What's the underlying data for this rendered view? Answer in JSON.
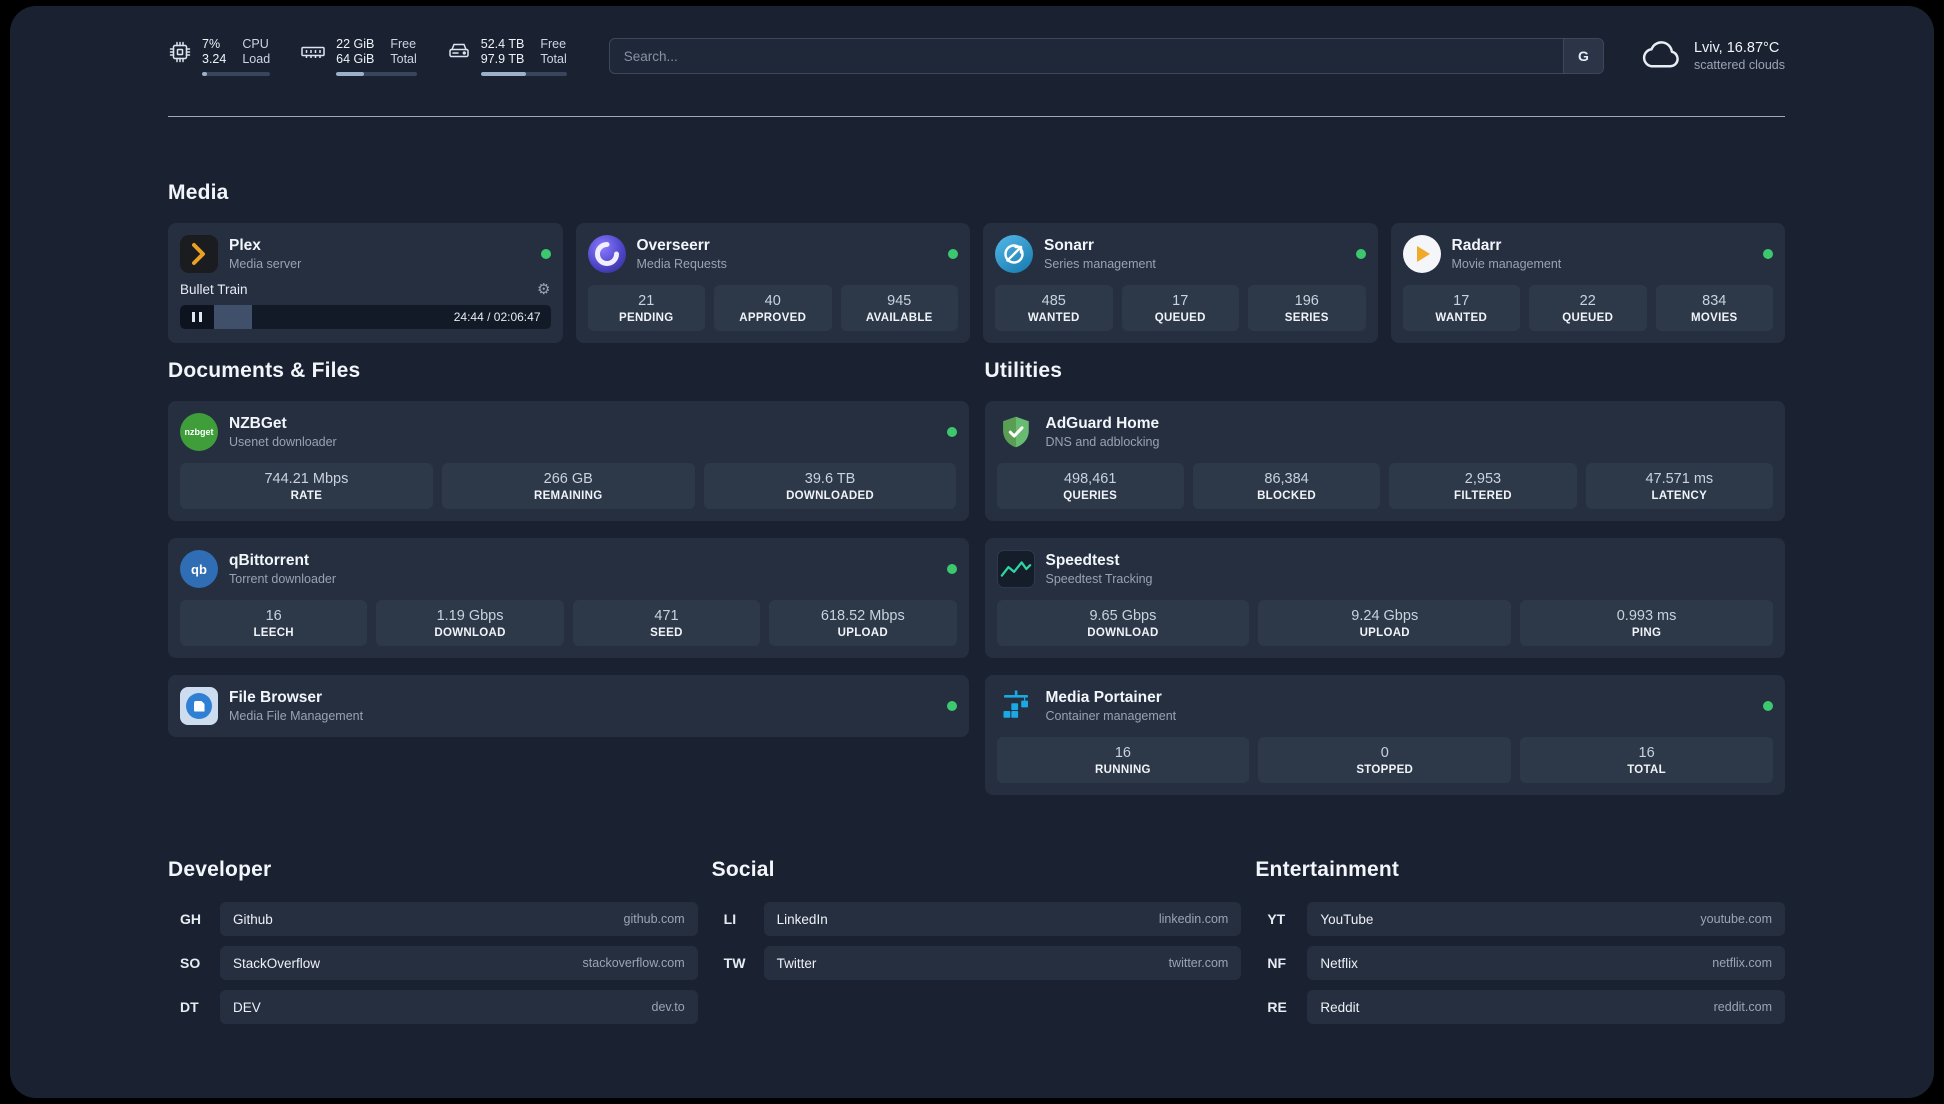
{
  "header": {
    "cpu": {
      "value_top": "7%",
      "value_bottom": "3.24",
      "label_top": "CPU",
      "label_bottom": "Load",
      "bar_percent": 7
    },
    "memory": {
      "value_top": "22 GiB",
      "value_bottom": "64 GiB",
      "label_top": "Free",
      "label_bottom": "Total",
      "bar_percent": 34
    },
    "storage": {
      "value_top": "52.4 TB",
      "value_bottom": "97.9 TB",
      "label_top": "Free",
      "label_bottom": "Total",
      "bar_percent": 53
    },
    "search": {
      "placeholder": "Search...",
      "engine_label": "G"
    },
    "weather": {
      "location": "Lviv, 16.87°C",
      "condition": "scattered clouds"
    }
  },
  "media": {
    "title": "Media",
    "plex": {
      "name": "Plex",
      "subtitle": "Media server",
      "now_playing": "Bullet Train",
      "time": "24:44 / 02:06:47",
      "progress_percent": 19.5
    },
    "overseerr": {
      "name": "Overseerr",
      "subtitle": "Media Requests",
      "stats": [
        {
          "value": "21",
          "label": "PENDING"
        },
        {
          "value": "40",
          "label": "APPROVED"
        },
        {
          "value": "945",
          "label": "AVAILABLE"
        }
      ]
    },
    "sonarr": {
      "name": "Sonarr",
      "subtitle": "Series management",
      "stats": [
        {
          "value": "485",
          "label": "WANTED"
        },
        {
          "value": "17",
          "label": "QUEUED"
        },
        {
          "value": "196",
          "label": "SERIES"
        }
      ]
    },
    "radarr": {
      "name": "Radarr",
      "subtitle": "Movie management",
      "stats": [
        {
          "value": "17",
          "label": "WANTED"
        },
        {
          "value": "22",
          "label": "QUEUED"
        },
        {
          "value": "834",
          "label": "MOVIES"
        }
      ]
    }
  },
  "documents": {
    "title": "Documents & Files",
    "nzbget": {
      "name": "NZBGet",
      "subtitle": "Usenet downloader",
      "icon_text": "nzbget",
      "stats": [
        {
          "value": "744.21 Mbps",
          "label": "RATE"
        },
        {
          "value": "266 GB",
          "label": "REMAINING"
        },
        {
          "value": "39.6 TB",
          "label": "DOWNLOADED"
        }
      ]
    },
    "qbittorrent": {
      "name": "qBittorrent",
      "subtitle": "Torrent downloader",
      "icon_text": "qb",
      "stats": [
        {
          "value": "16",
          "label": "LEECH"
        },
        {
          "value": "1.19 Gbps",
          "label": "DOWNLOAD"
        },
        {
          "value": "471",
          "label": "SEED"
        },
        {
          "value": "618.52 Mbps",
          "label": "UPLOAD"
        }
      ]
    },
    "filebrowser": {
      "name": "File Browser",
      "subtitle": "Media File Management"
    }
  },
  "utilities": {
    "title": "Utilities",
    "adguard": {
      "name": "AdGuard Home",
      "subtitle": "DNS and adblocking",
      "stats": [
        {
          "value": "498,461",
          "label": "QUERIES"
        },
        {
          "value": "86,384",
          "label": "BLOCKED"
        },
        {
          "value": "2,953",
          "label": "FILTERED"
        },
        {
          "value": "47.571 ms",
          "label": "LATENCY"
        }
      ]
    },
    "speedtest": {
      "name": "Speedtest",
      "subtitle": "Speedtest Tracking",
      "stats": [
        {
          "value": "9.65 Gbps",
          "label": "DOWNLOAD"
        },
        {
          "value": "9.24 Gbps",
          "label": "UPLOAD"
        },
        {
          "value": "0.993 ms",
          "label": "PING"
        }
      ]
    },
    "portainer": {
      "name": "Media Portainer",
      "subtitle": "Container management",
      "stats": [
        {
          "value": "16",
          "label": "RUNNING"
        },
        {
          "value": "0",
          "label": "STOPPED"
        },
        {
          "value": "16",
          "label": "TOTAL"
        }
      ]
    }
  },
  "developer": {
    "title": "Developer",
    "bookmarks": [
      {
        "abbr": "GH",
        "name": "Github",
        "url": "github.com"
      },
      {
        "abbr": "SO",
        "name": "StackOverflow",
        "url": "stackoverflow.com"
      },
      {
        "abbr": "DT",
        "name": "DEV",
        "url": "dev.to"
      }
    ]
  },
  "social": {
    "title": "Social",
    "bookmarks": [
      {
        "abbr": "LI",
        "name": "LinkedIn",
        "url": "linkedin.com"
      },
      {
        "abbr": "TW",
        "name": "Twitter",
        "url": "twitter.com"
      }
    ]
  },
  "entertainment": {
    "title": "Entertainment",
    "bookmarks": [
      {
        "abbr": "YT",
        "name": "YouTube",
        "url": "youtube.com"
      },
      {
        "abbr": "NF",
        "name": "Netflix",
        "url": "netflix.com"
      },
      {
        "abbr": "RE",
        "name": "Reddit",
        "url": "reddit.com"
      }
    ]
  }
}
